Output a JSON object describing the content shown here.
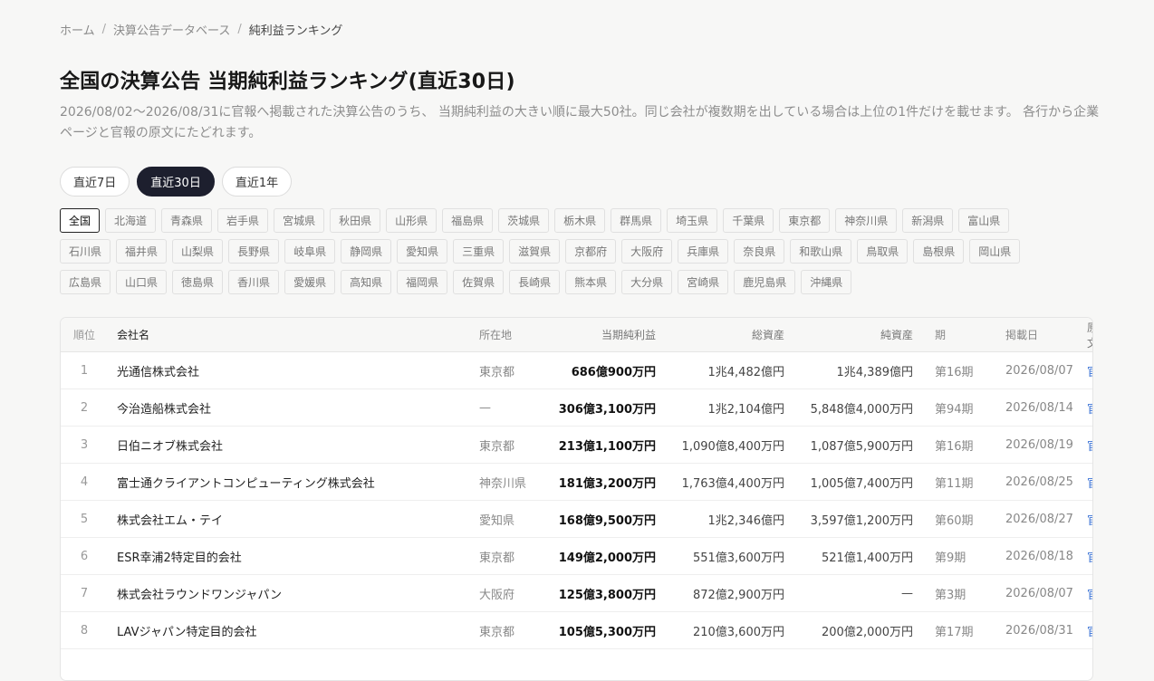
{
  "breadcrumb": {
    "home": "ホーム",
    "sep": "/",
    "database": "決算公告データベース",
    "current": "純利益ランキング"
  },
  "page": {
    "title": "全国の決算公告 当期純利益ランキング(直近30日)",
    "description": "2026/08/02〜2026/08/31に官報へ掲載された決算公告のうち、 当期純利益の大きい順に最大50社。同じ会社が複数期を出している場合は上位の1件だけを載せます。 各行から企業ページと官報の原文にたどれます。"
  },
  "period_tabs": [
    {
      "label": "直近7日",
      "active": false
    },
    {
      "label": "直近30日",
      "active": true
    },
    {
      "label": "直近1年",
      "active": false
    }
  ],
  "prefectures": [
    {
      "label": "全国",
      "active": true
    },
    {
      "label": "北海道"
    },
    {
      "label": "青森県"
    },
    {
      "label": "岩手県"
    },
    {
      "label": "宮城県"
    },
    {
      "label": "秋田県"
    },
    {
      "label": "山形県"
    },
    {
      "label": "福島県"
    },
    {
      "label": "茨城県"
    },
    {
      "label": "栃木県"
    },
    {
      "label": "群馬県"
    },
    {
      "label": "埼玉県"
    },
    {
      "label": "千葉県"
    },
    {
      "label": "東京都"
    },
    {
      "label": "神奈川県"
    },
    {
      "label": "新潟県"
    },
    {
      "label": "富山県"
    },
    {
      "label": "石川県"
    },
    {
      "label": "福井県"
    },
    {
      "label": "山梨県"
    },
    {
      "label": "長野県"
    },
    {
      "label": "岐阜県"
    },
    {
      "label": "静岡県"
    },
    {
      "label": "愛知県"
    },
    {
      "label": "三重県"
    },
    {
      "label": "滋賀県"
    },
    {
      "label": "京都府"
    },
    {
      "label": "大阪府"
    },
    {
      "label": "兵庫県"
    },
    {
      "label": "奈良県"
    },
    {
      "label": "和歌山県"
    },
    {
      "label": "鳥取県"
    },
    {
      "label": "島根県"
    },
    {
      "label": "岡山県"
    },
    {
      "label": "広島県"
    },
    {
      "label": "山口県"
    },
    {
      "label": "徳島県"
    },
    {
      "label": "香川県"
    },
    {
      "label": "愛媛県"
    },
    {
      "label": "高知県"
    },
    {
      "label": "福岡県"
    },
    {
      "label": "佐賀県"
    },
    {
      "label": "長崎県"
    },
    {
      "label": "熊本県"
    },
    {
      "label": "大分県"
    },
    {
      "label": "宮崎県"
    },
    {
      "label": "鹿児島県"
    },
    {
      "label": "沖縄県"
    }
  ],
  "table": {
    "headers": {
      "rank": "順位",
      "company": "会社名",
      "location": "所在地",
      "net_income": "当期純利益",
      "total_assets": "総資産",
      "net_assets": "純資産",
      "term": "期",
      "date": "掲載日",
      "source": "原文"
    },
    "rows": [
      {
        "rank": "1",
        "company": "光通信株式会社",
        "location": "東京都",
        "net_income": "686億900万円",
        "total_assets": "1兆4,482億円",
        "net_assets": "1兆4,389億円",
        "term": "第16期",
        "date": "2026/08/07",
        "source": "官報"
      },
      {
        "rank": "2",
        "company": "今治造船株式会社",
        "location": "—",
        "net_income": "306億3,100万円",
        "total_assets": "1兆2,104億円",
        "net_assets": "5,848億4,000万円",
        "term": "第94期",
        "date": "2026/08/14",
        "source": "官報"
      },
      {
        "rank": "3",
        "company": "日伯ニオブ株式会社",
        "location": "東京都",
        "net_income": "213億1,100万円",
        "total_assets": "1,090億8,400万円",
        "net_assets": "1,087億5,900万円",
        "term": "第16期",
        "date": "2026/08/19",
        "source": "官報"
      },
      {
        "rank": "4",
        "company": "富士通クライアントコンピューティング株式会社",
        "location": "神奈川県",
        "net_income": "181億3,200万円",
        "total_assets": "1,763億4,400万円",
        "net_assets": "1,005億7,400万円",
        "term": "第11期",
        "date": "2026/08/25",
        "source": "官報"
      },
      {
        "rank": "5",
        "company": "株式会社エム・テイ",
        "location": "愛知県",
        "net_income": "168億9,500万円",
        "total_assets": "1兆2,346億円",
        "net_assets": "3,597億1,200万円",
        "term": "第60期",
        "date": "2026/08/27",
        "source": "官報"
      },
      {
        "rank": "6",
        "company": "ESR幸浦2特定目的会社",
        "location": "東京都",
        "net_income": "149億2,000万円",
        "total_assets": "551億3,600万円",
        "net_assets": "521億1,400万円",
        "term": "第9期",
        "date": "2026/08/18",
        "source": "官報"
      },
      {
        "rank": "7",
        "company": "株式会社ラウンドワンジャパン",
        "location": "大阪府",
        "net_income": "125億3,800万円",
        "total_assets": "872億2,900万円",
        "net_assets": "—",
        "term": "第3期",
        "date": "2026/08/07",
        "source": "官報"
      },
      {
        "rank": "8",
        "company": "LAVジャパン特定目的会社",
        "location": "東京都",
        "net_income": "105億5,300万円",
        "total_assets": "210億3,600万円",
        "net_assets": "200億2,000万円",
        "term": "第17期",
        "date": "2026/08/31",
        "source": "官報"
      }
    ]
  }
}
